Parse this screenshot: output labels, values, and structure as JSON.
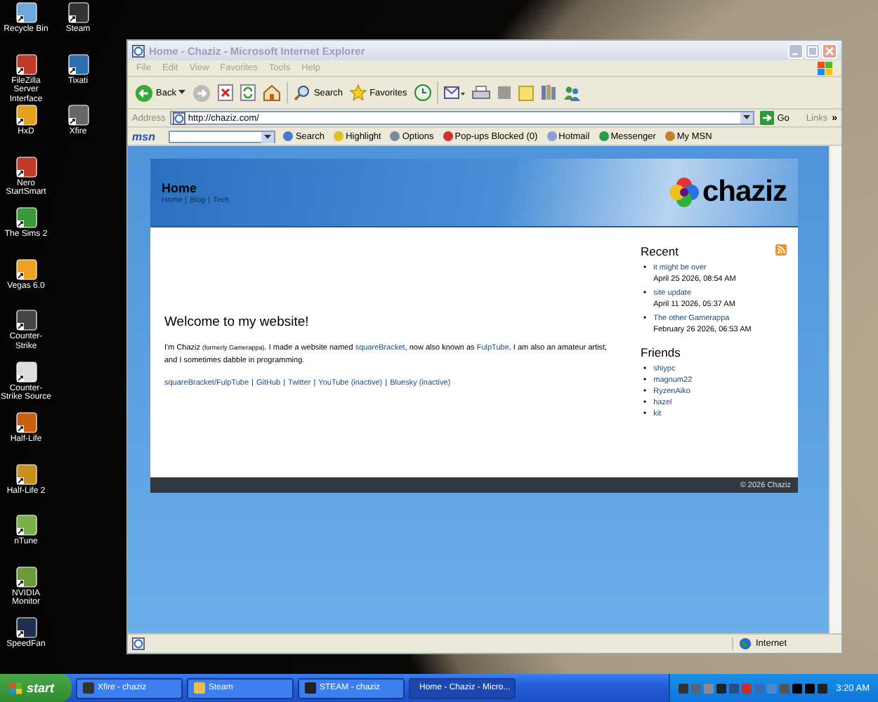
{
  "desktop": {
    "icon_rows": [
      [
        "Recycle Bin",
        "Steam"
      ],
      [
        "FileZilla Server Interface",
        "Tixati"
      ],
      [
        "HxD",
        "Xfire"
      ],
      [
        "Nero StartSmart"
      ],
      [
        "The Sims 2"
      ],
      [
        "Vegas 6.0"
      ],
      [
        "Counter-Strike"
      ],
      [
        "Counter-Strike Source"
      ],
      [
        "Half-Life"
      ],
      [
        "Half-Life 2"
      ],
      [
        "nTune"
      ],
      [
        "NVIDIA Monitor"
      ],
      [
        "SpeedFan"
      ]
    ]
  },
  "window": {
    "title": "Home - Chaziz - Microsoft Internet Explorer",
    "menu": [
      "File",
      "Edit",
      "View",
      "Favorites",
      "Tools",
      "Help"
    ],
    "toolbar": [
      "Back",
      "Search",
      "Favorites"
    ],
    "address": {
      "label": "Address",
      "value": "http://chaziz.com/",
      "go": "Go",
      "links": "Links",
      "chevron": "»"
    },
    "msn_toolbar": {
      "logo": "msn",
      "items": [
        "Search",
        "Highlight",
        "Options",
        "Pop-ups Blocked (0)",
        "Hotmail",
        "Messenger",
        "My MSN"
      ]
    },
    "status_bar": {
      "zone": "Internet"
    }
  },
  "page": {
    "header": {
      "title": "Home",
      "nav": [
        "Home",
        "Blog",
        "Tech"
      ],
      "separator": "|",
      "logo": "chaziz"
    },
    "welcome": {
      "heading": "Welcome to my website!",
      "paragraph": [
        {
          "kind": "text",
          "text": "I'm Chaziz "
        },
        {
          "kind": "small",
          "text": "(formerly Gamerappa)"
        },
        {
          "kind": "text",
          "text": ". I made a website named "
        },
        {
          "kind": "link",
          "text": "squareBracket"
        },
        {
          "kind": "text",
          "text": ", now also known as "
        },
        {
          "kind": "link",
          "text": "FulpTube"
        },
        {
          "kind": "text",
          "text": ". I am also an amateur artist, and I sometimes dabble in programming."
        }
      ],
      "links": [
        "squareBracket/FulpTube",
        "GitHub",
        "Twitter",
        "YouTube (inactive)",
        "Bluesky (inactive)"
      ],
      "separator": "|"
    },
    "recent": {
      "title": "Recent",
      "bullet": "•",
      "posts": [
        {
          "title": "it might be over",
          "date": "April 25 2026, 08:54 AM"
        },
        {
          "title": "site update",
          "date": "April 11 2026, 05:37 AM"
        },
        {
          "title": "The other Gamerappa",
          "date": "February 26 2026, 06:53 AM"
        }
      ]
    },
    "friends": {
      "title": "Friends",
      "bullet": "•",
      "items": [
        "shiypc",
        "magnum22",
        "RyzenAiko",
        "hazel",
        "kit"
      ]
    },
    "footer": "© 2026 Chaziz"
  },
  "taskbar": {
    "start": "start",
    "tasks": [
      {
        "label": "Xfire - chaziz",
        "selected": false
      },
      {
        "label": "Steam",
        "selected": false
      },
      {
        "label": "STEAM - chaziz",
        "selected": false
      },
      {
        "label": "Home - Chaziz - Micro...",
        "selected": true
      }
    ],
    "clock": "3:20 AM"
  }
}
